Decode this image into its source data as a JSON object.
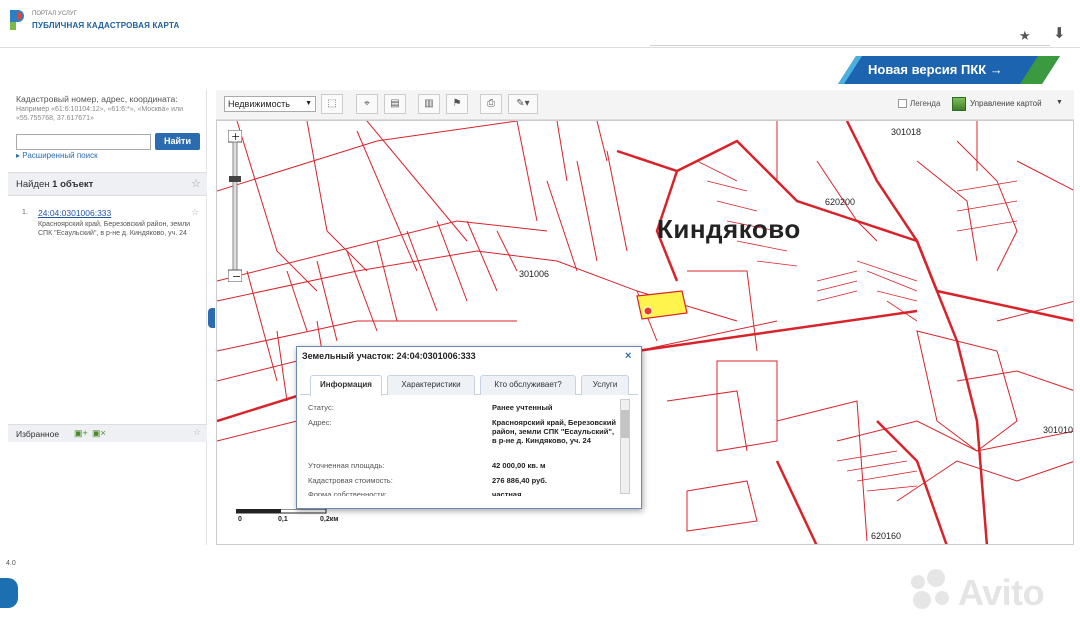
{
  "browser": {
    "star_icon": "★",
    "download_icon": "⬇"
  },
  "header": {
    "logo_small": "ПОРТАЛ УСЛУГ",
    "logo_title": "ПУБЛИЧНАЯ КАДАСТРОВАЯ КАРТА",
    "new_version_label": "Новая версия ПКК →",
    "accent_color": "#1c5f9e"
  },
  "search": {
    "hint": "Кадастровый номер, адрес, координата:",
    "example": "Например «61:6:10104:12», «61:6:*», «Москва» или «55.755768, 37.617671»",
    "input_value": "",
    "button_label": "Найти",
    "advanced_label": "Расширенный поиск"
  },
  "results": {
    "found_prefix": "Найден ",
    "found_count": "1 объект",
    "items": [
      {
        "num": "1.",
        "cadastral": "24:04:0301006:333",
        "address": "Красноярский край, Березовский район, земли СПК \"Есаульский\", в р-не д. Киндяково, уч. 24"
      }
    ]
  },
  "favorites": {
    "title": "Избранное"
  },
  "toolbar": {
    "layer_select": "Недвижимость",
    "legend_label": "Легенда",
    "map_control_label": "Управление картой"
  },
  "map": {
    "place_name": "Киндяково",
    "labels": [
      {
        "t": "301018"
      },
      {
        "t": "620200"
      },
      {
        "t": "301006"
      },
      {
        "t": "620160"
      },
      {
        "t": "301010"
      }
    ],
    "scale": {
      "zero": "0",
      "mid": "0,1",
      "end": "0,2км"
    }
  },
  "popup": {
    "title": "Земельный участок: 24:04:0301006:333",
    "tabs": [
      "Информация",
      "Характеристики",
      "Кто обслуживает?",
      "Услуги"
    ],
    "rows": [
      {
        "k": "Статус:",
        "v": "Ранее учтенный"
      },
      {
        "k": "Адрес:",
        "v": "Красноярский край, Березовский район, земли СПК \"Есаульский\", в р-не д. Киндяково, уч. 24"
      },
      {
        "k": "Уточненная площадь:",
        "v": "42 000,00 кв. м"
      },
      {
        "k": "Кадастровая стоимость:",
        "v": "276 886,40 руб."
      },
      {
        "k": "Форма собственности:",
        "v": "частная"
      }
    ]
  },
  "footer": {
    "text": "4.0"
  },
  "watermark": {
    "text": "Avito"
  }
}
